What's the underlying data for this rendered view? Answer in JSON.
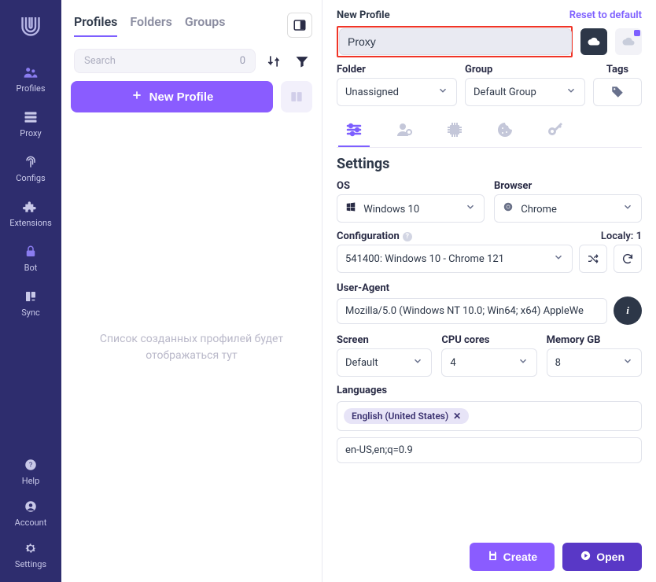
{
  "sidebar": {
    "items": [
      {
        "label": "Profiles"
      },
      {
        "label": "Proxy"
      },
      {
        "label": "Configs"
      },
      {
        "label": "Extensions"
      },
      {
        "label": "Bot"
      },
      {
        "label": "Sync"
      }
    ],
    "bottom": [
      {
        "label": "Help"
      },
      {
        "label": "Account"
      },
      {
        "label": "Settings"
      }
    ]
  },
  "middle": {
    "tabs": [
      "Profiles",
      "Folders",
      "Groups"
    ],
    "search_placeholder": "Search",
    "search_count": "0",
    "new_profile_label": "New Profile",
    "empty_message": "Список созданных профилей будет отображаться тут"
  },
  "panel": {
    "title": "New Profile",
    "reset": "Reset to default",
    "name_value": "Proxy",
    "folder_label": "Folder",
    "folder_value": "Unassigned",
    "group_label": "Group",
    "group_value": "Default Group",
    "tags_label": "Tags",
    "settings_title": "Settings",
    "os_label": "OS",
    "os_value": "Windows 10",
    "browser_label": "Browser",
    "browser_value": "Chrome",
    "config_label": "Configuration",
    "locally": "Localy: 1",
    "config_value": "541400: Windows 10 - Chrome 121",
    "ua_label": "User-Agent",
    "ua_value": "Mozilla/5.0 (Windows NT 10.0; Win64; x64) AppleWe",
    "screen_label": "Screen",
    "screen_value": "Default",
    "cpu_label": "CPU cores",
    "cpu_value": "4",
    "memory_label": "Memory GB",
    "memory_value": "8",
    "lang_label": "Languages",
    "lang_chip": "English (United States)",
    "lang_text": "en-US,en;q=0.9",
    "create": "Create",
    "open": "Open"
  }
}
